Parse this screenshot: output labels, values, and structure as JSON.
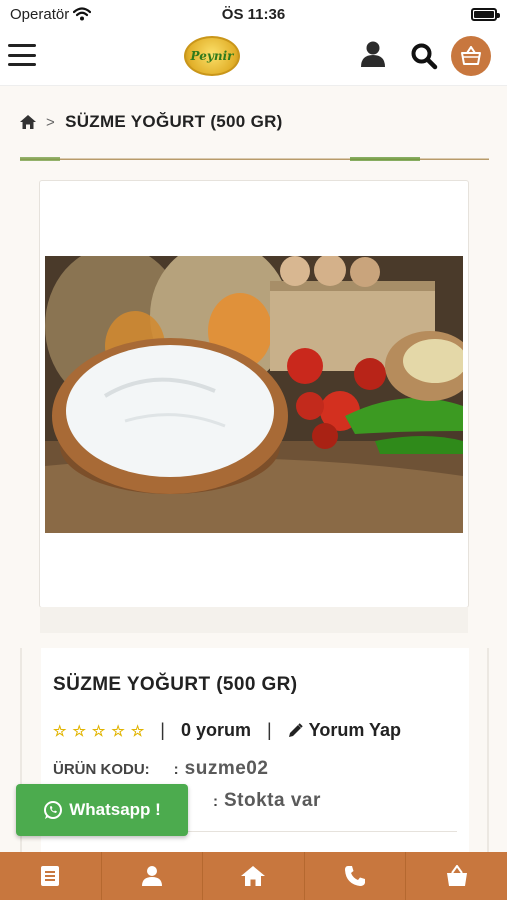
{
  "status_bar": {
    "carrier": "Operatör",
    "time": "ÖS 11:36"
  },
  "header": {
    "logo_text": "Peynir",
    "icons": [
      "menu-icon",
      "user-icon",
      "search-icon",
      "basket-icon"
    ]
  },
  "breadcrumb": {
    "home_icon": "home-icon",
    "separator": ">",
    "current": "SÜZME YOĞURT (500 GR)"
  },
  "product": {
    "image_alt": "Süzme yoğurt",
    "title": "SÜZME YOĞURT (500 GR)",
    "rating": 0,
    "rating_max": 5,
    "review_count_label": "0 yorum",
    "write_review_label": "Yorum Yap",
    "code_label": "ÜRÜN KODU:",
    "code_colon": ":",
    "code_value": "suzme02",
    "stock_colon": ":",
    "stock_value": "Stokta var"
  },
  "whatsapp": {
    "label": "Whatsapp !"
  },
  "bottom_nav": {
    "items": [
      "list-icon",
      "user-icon",
      "home-icon",
      "phone-icon",
      "basket-icon"
    ]
  },
  "colors": {
    "accent": "#c8773e",
    "whatsapp": "#4cab4e",
    "star": "#e1b400"
  }
}
